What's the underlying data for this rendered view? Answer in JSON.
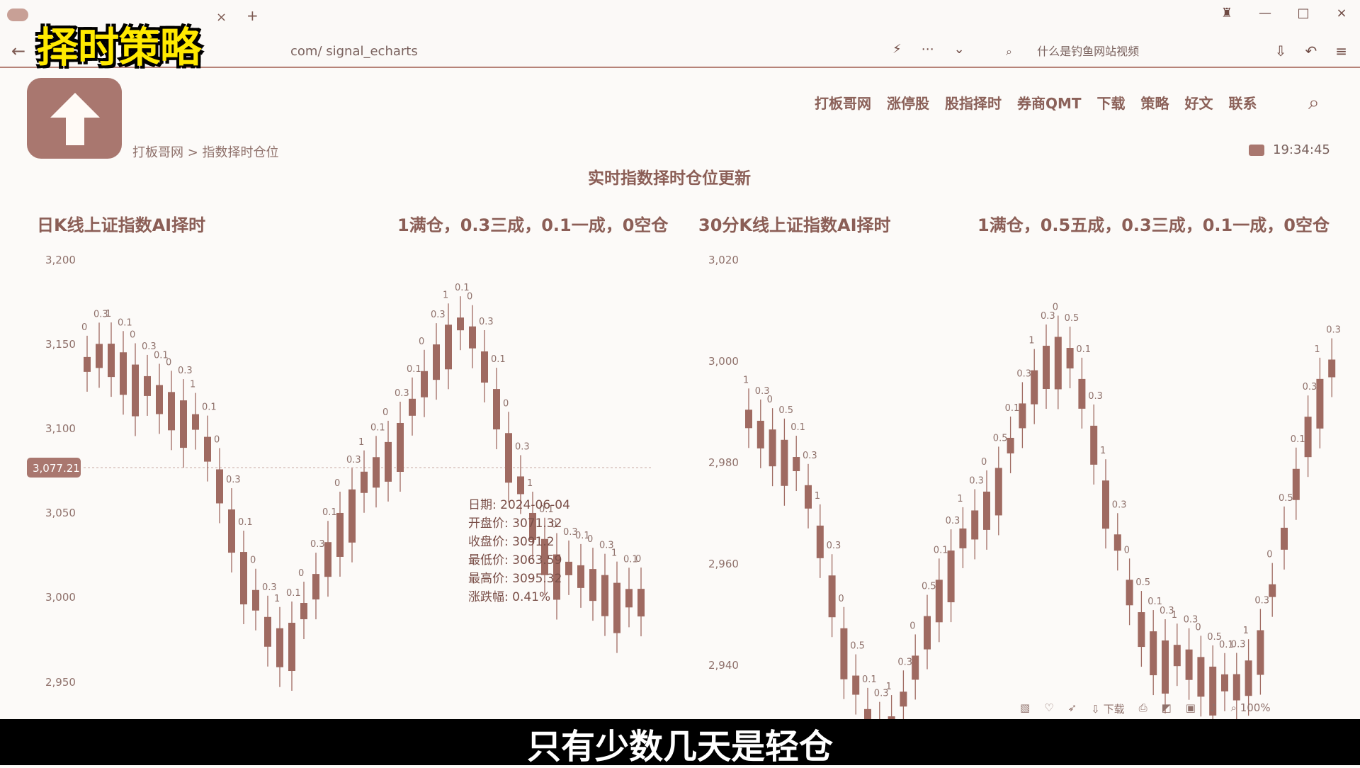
{
  "browser": {
    "url_text": "com/ signal_echarts",
    "search_placeholder": "什么是钓鱼网站视频",
    "tab_close": "×",
    "tab_plus": "+"
  },
  "overlay": {
    "title": "择时策略"
  },
  "site": {
    "nav": [
      "打板哥网",
      "涨停股",
      "股指择时",
      "券商QMT",
      "下载",
      "策略",
      "好文",
      "联系"
    ],
    "breadcrumb": "打板哥网 > 指数择时仓位",
    "time": "19:34:45",
    "page_title": "实时指数择时仓位更新"
  },
  "charts": {
    "left_title": "日K线上证指数AI择时",
    "left_legend": "1满仓，0.3三成，0.1一成，0空仓",
    "right_title": "30分K线上证指数AI择时",
    "right_legend": "1满仓，0.5五成，0.3三成，0.1一成，0空仓",
    "left_ticks": [
      "3,200",
      "3,150",
      "3,100",
      "3,050",
      "3,000",
      "2,950"
    ],
    "right_ticks": [
      "3,020",
      "3,000",
      "2,980",
      "2,960",
      "2,940"
    ],
    "crosshair_value": "3,077.21",
    "tooltip": [
      "日期: 2024-06-04",
      "开盘价: 3071.32",
      "收盘价: 3091.2",
      "最低价: 3063.59",
      "最高价: 3095.32",
      "涨跌幅: 0.41%"
    ]
  },
  "toolbar": {
    "download_label": "下载",
    "zoom": "100%"
  },
  "caption": "只有少数几天是轻仓",
  "colors": {
    "accent": "#a9776f",
    "candle": "#9f6a61",
    "text": "#8b5e56"
  },
  "chart_data": [
    {
      "type": "candlestick",
      "title": "日K线上证指数AI择时",
      "ylim": [
        2950,
        3200
      ],
      "annotations": [
        "0",
        "0.3",
        "1",
        "0.1",
        "0",
        "0.3",
        "0.1"
      ]
    },
    {
      "type": "candlestick",
      "title": "30分K线上证指数AI择时",
      "ylim": [
        2940,
        3020
      ],
      "annotations": [
        "1",
        "0.3",
        "0",
        "0.5",
        "0.1",
        "0.3"
      ]
    }
  ]
}
